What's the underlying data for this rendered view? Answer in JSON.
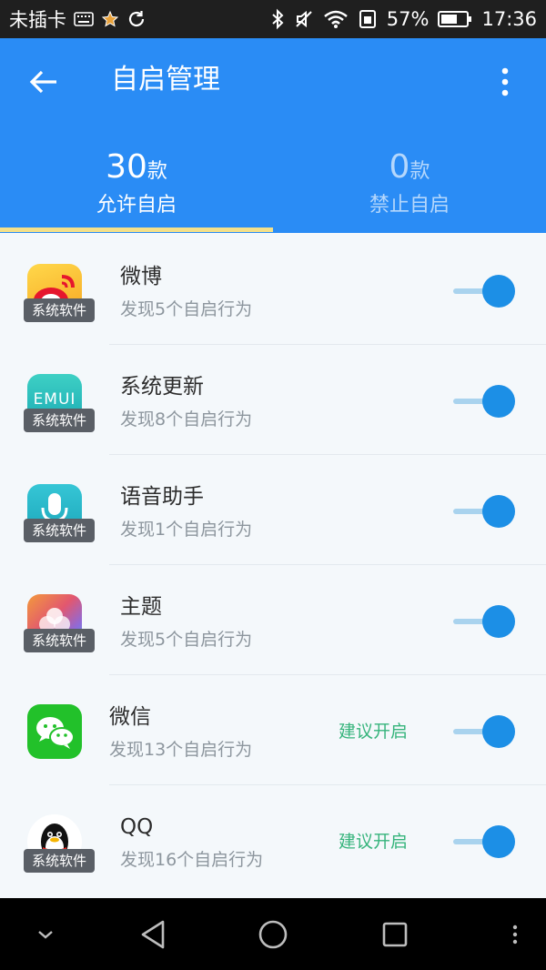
{
  "status_bar": {
    "carrier": "未插卡",
    "battery_percent": "57%",
    "time": "17:36"
  },
  "app_bar": {
    "title": "自启管理"
  },
  "tabs": [
    {
      "count": "30",
      "unit": "款",
      "label": "允许自启",
      "selected": true
    },
    {
      "count": "0",
      "unit": "款",
      "label": "禁止自启",
      "selected": false
    }
  ],
  "apps": [
    {
      "name": "微博",
      "desc": "发现5个自启行为",
      "badge": "系统软件",
      "suggest": "",
      "enabled": true,
      "icon": "weibo-icon"
    },
    {
      "name": "系统更新",
      "desc": "发现8个自启行为",
      "badge": "系统软件",
      "suggest": "",
      "enabled": true,
      "icon": "emui-update-icon",
      "icon_text": "EMUI"
    },
    {
      "name": "语音助手",
      "desc": "发现1个自启行为",
      "badge": "系统软件",
      "suggest": "",
      "enabled": true,
      "icon": "microphone-icon"
    },
    {
      "name": "主题",
      "desc": "发现5个自启行为",
      "badge": "系统软件",
      "suggest": "",
      "enabled": true,
      "icon": "theme-icon"
    },
    {
      "name": "微信",
      "desc": "发现13个自启行为",
      "badge": "",
      "suggest": "建议开启",
      "enabled": true,
      "icon": "wechat-icon"
    },
    {
      "name": "QQ",
      "desc": "发现16个自启行为",
      "badge": "系统软件",
      "suggest": "建议开启",
      "enabled": true,
      "icon": "qq-penguin-icon"
    }
  ],
  "colors": {
    "app_bar": "#2a8cf5",
    "tab_indicator": "#f3e08a",
    "toggle_on": "#1c8fe6",
    "suggest_text": "#36b47c"
  }
}
